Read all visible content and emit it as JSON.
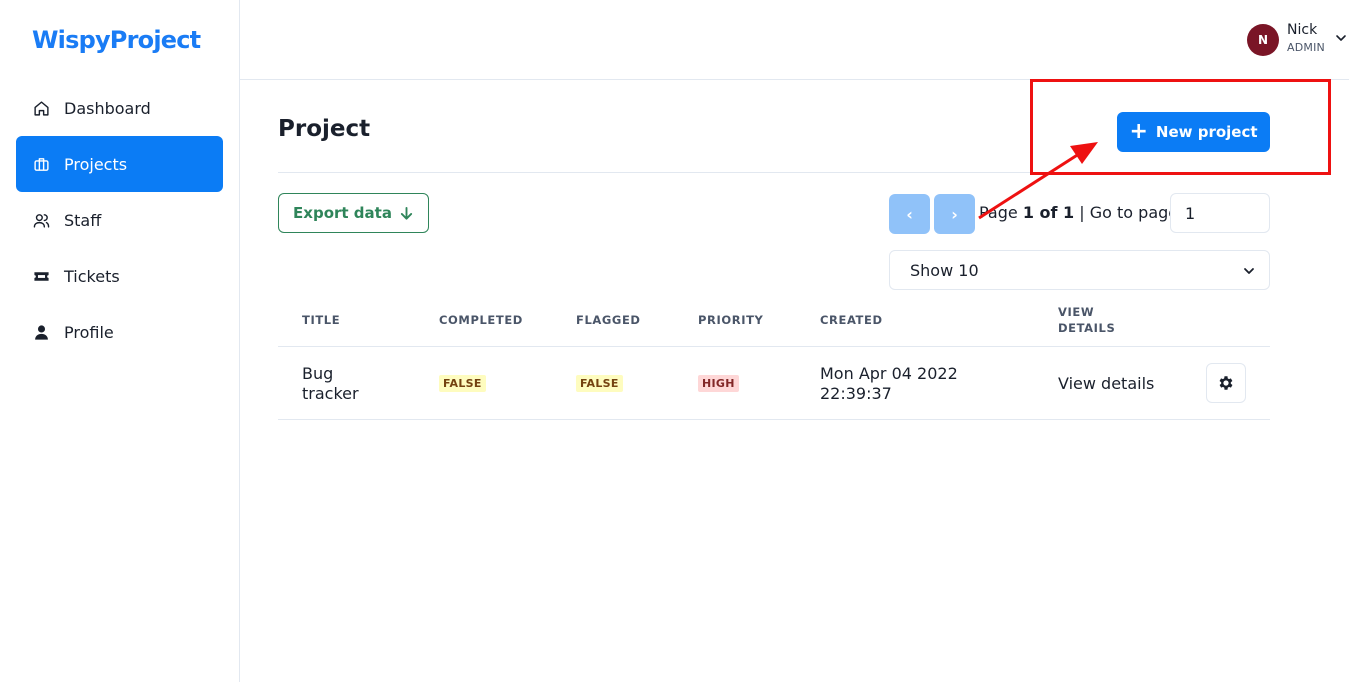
{
  "app": {
    "logo": "WispyProject"
  },
  "sidebar": {
    "items": [
      {
        "label": "Dashboard",
        "icon": "home-icon",
        "active": false
      },
      {
        "label": "Projects",
        "icon": "briefcase-icon",
        "active": true
      },
      {
        "label": "Staff",
        "icon": "users-icon",
        "active": false
      },
      {
        "label": "Tickets",
        "icon": "ticket-icon",
        "active": false
      },
      {
        "label": "Profile",
        "icon": "user-icon",
        "active": false
      }
    ]
  },
  "header": {
    "user": {
      "initial": "N",
      "name": "Nick",
      "role": "ADMIN"
    }
  },
  "main": {
    "title": "Project",
    "new_button": "New project",
    "export_button": "Export data",
    "pagination": {
      "prev": "‹",
      "next": "›",
      "page_prefix": "Page ",
      "page_current": "1 of 1",
      "goto_label": " | Go to page:",
      "goto_value": "1"
    },
    "page_size": "Show 10",
    "table": {
      "headers": [
        "TITLE",
        "COMPLETED",
        "FLAGGED",
        "PRIORITY",
        "CREATED",
        "VIEW DETAILS"
      ],
      "rows": [
        {
          "title": "Bug tracker",
          "completed": "FALSE",
          "flagged": "FALSE",
          "priority": "HIGH",
          "created": "Mon Apr 04 2022 22:39:37",
          "view_details": "View details"
        }
      ]
    }
  },
  "colors": {
    "brand": "#1a7cf5",
    "primary": "#0b7cf5",
    "export_green": "#2f855a",
    "avatar": "#7a1526",
    "annotation": "#ee1111"
  }
}
